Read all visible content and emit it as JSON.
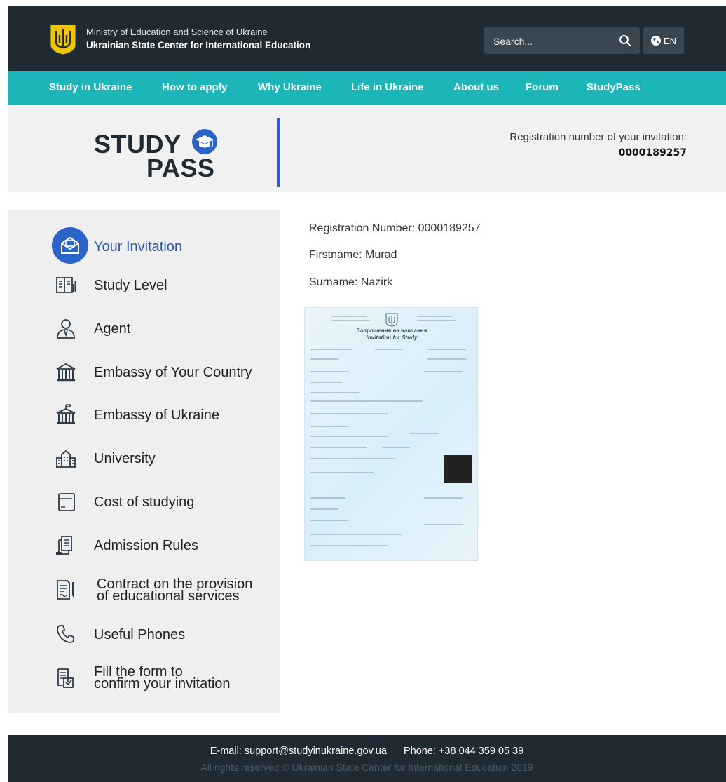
{
  "header": {
    "org_line1": "Ministry of Education and Science of Ukraine",
    "org_line2": "Ukrainian State Center for International Education",
    "search_placeholder": "Search...",
    "language": "EN"
  },
  "nav": [
    "Study in Ukraine",
    "How to apply",
    "Why Ukraine",
    "Life in Ukraine",
    "About us",
    "Forum",
    "StudyPass"
  ],
  "banner": {
    "logo_top": "STUDY",
    "logo_bottom": "PASS",
    "reg_label": "Registration number of your invitation:",
    "reg_value": "0000189257"
  },
  "sidebar": [
    {
      "label": "Your Invitation",
      "icon": "envelope-icon",
      "active": true
    },
    {
      "label": "Study Level",
      "icon": "book-chart-icon"
    },
    {
      "label": "Agent",
      "icon": "person-icon"
    },
    {
      "label": "Embassy of Your Country",
      "icon": "building-columns-icon"
    },
    {
      "label": "Embassy of Ukraine",
      "icon": "embassy-flag-icon"
    },
    {
      "label": "University",
      "icon": "university-icon"
    },
    {
      "label": "Cost of studying",
      "icon": "wallet-icon"
    },
    {
      "label": "Admission Rules",
      "icon": "documents-icon"
    },
    {
      "label": "Contract on the provision",
      "label2": "of educational services",
      "icon": "contract-pen-icon"
    },
    {
      "label": "Useful Phones",
      "icon": "phone-icon"
    },
    {
      "label": "Fill the form to",
      "label2": "confirm your invitation",
      "icon": "form-check-icon"
    }
  ],
  "details": {
    "registration_number": "Registration Number: 0000189257",
    "firstname": "Firstname: Murad",
    "surname": "Surname: Nazirk"
  },
  "document": {
    "title_ua": "Запрошення на навчання",
    "title_en": "Invitation for Study"
  },
  "footer": {
    "email": "E-mail: support@studyinukraine.gov.ua",
    "phone": "Phone: +38 044 359 05 39",
    "copyright": "All rights reserved © Ukrainian State Center for International Education 2019"
  },
  "colors": {
    "header_bg": "#1f2a33",
    "nav_bg": "#1cb6b8",
    "accent_blue": "#2a58b6",
    "divider_blue": "#2f5bd3"
  }
}
